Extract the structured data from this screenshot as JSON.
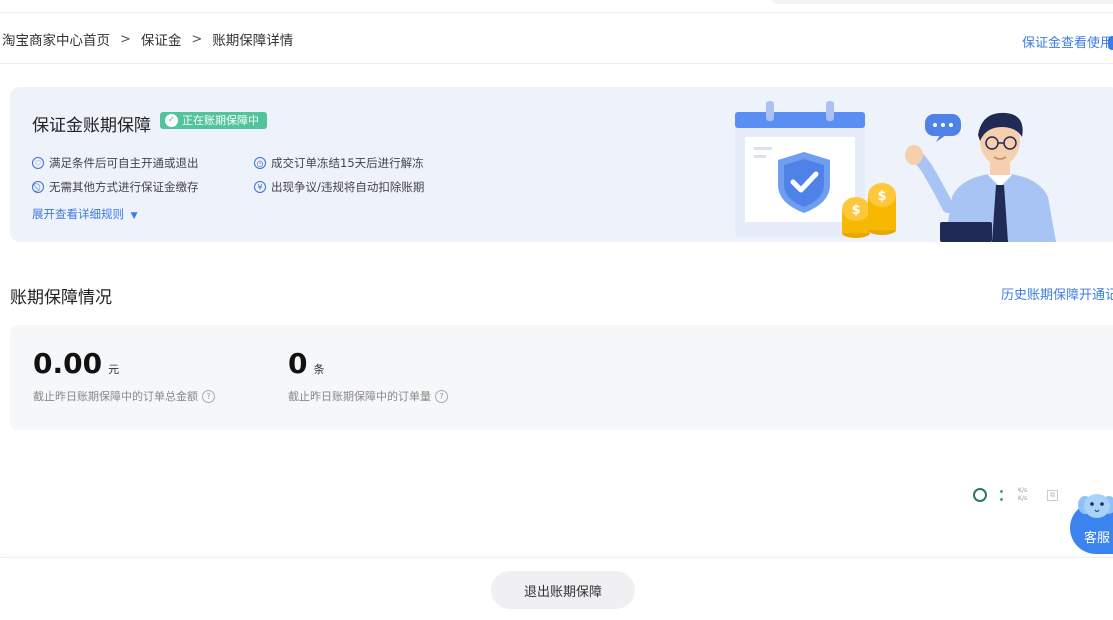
{
  "header": {
    "breadcrumb": [
      {
        "label": "淘宝商家中心首页"
      },
      {
        "label": "保证金"
      },
      {
        "label": "账期保障详情"
      }
    ],
    "separator": ">",
    "right_link": "保证金查看使用"
  },
  "banner": {
    "title": "保证金账期保障",
    "status_badge": "正在账期保障中",
    "features": [
      {
        "icon": "heart-check-icon",
        "text": "满足条件后可自主开通或退出"
      },
      {
        "icon": "clock-icon",
        "text": "成交订单冻结15天后进行解冻"
      },
      {
        "icon": "no-entry-icon",
        "text": "无需其他方式进行保证金缴存"
      },
      {
        "icon": "yen-icon",
        "text": "出现争议/违规将自动扣除账期"
      }
    ],
    "expand_link": "展开查看详细规则"
  },
  "section": {
    "title": "账期保障情况",
    "right_link": "历史账期保障开通记"
  },
  "stats": [
    {
      "value": "0.00",
      "unit": "元",
      "label": "截止昨日账期保障中的订单总金额"
    },
    {
      "value": "0",
      "unit": "条",
      "label": "截止昨日账期保障中的订单量"
    }
  ],
  "indicators": {
    "speed_up": "K/s",
    "speed_down": "K/s"
  },
  "customer_service": {
    "label": "客服"
  },
  "footer": {
    "exit_button": "退出账期保障"
  },
  "colors": {
    "accent": "#3d7be5",
    "badge": "#52c49b",
    "banner_bg": "#eef2fb",
    "card_bg": "#f6f7f9"
  }
}
